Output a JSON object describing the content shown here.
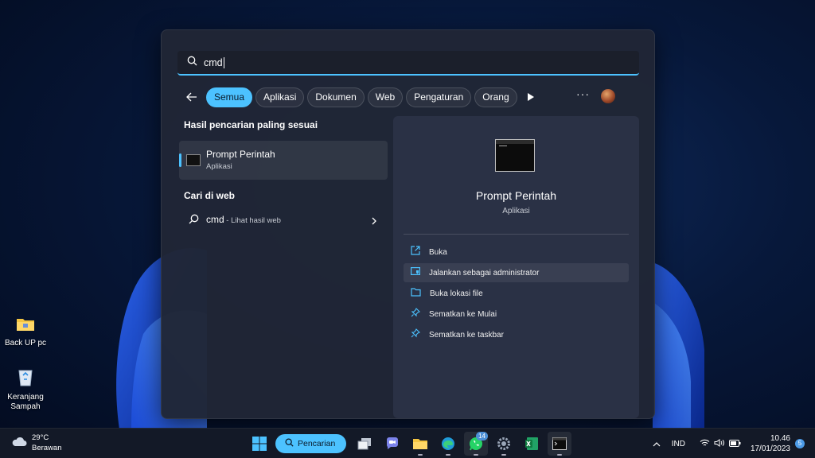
{
  "desktop": {
    "icons": [
      {
        "label": "Back UP pc",
        "icon": "folder-icon"
      },
      {
        "label": "Keranjang Sampah",
        "icon": "recycle-bin-icon"
      }
    ]
  },
  "search": {
    "query": "cmd",
    "filters": [
      "Semua",
      "Aplikasi",
      "Dokumen",
      "Web",
      "Pengaturan",
      "Orang"
    ],
    "active_filter": "Semua",
    "more_label": "···"
  },
  "results": {
    "best_match_title": "Hasil pencarian paling sesuai",
    "best_match": {
      "name": "Prompt Perintah",
      "type": "Aplikasi"
    },
    "web_title": "Cari di web",
    "web_row": {
      "query": "cmd",
      "suffix": " - Lihat hasil web"
    }
  },
  "detail": {
    "app_name": "Prompt Perintah",
    "app_type": "Aplikasi",
    "actions": [
      {
        "label": "Buka",
        "icon": "open-external-icon"
      },
      {
        "label": "Jalankan sebagai administrator",
        "icon": "admin-shield-icon"
      },
      {
        "label": "Buka lokasi file",
        "icon": "folder-icon"
      },
      {
        "label": "Sematkan ke Mulai",
        "icon": "pin-icon"
      },
      {
        "label": "Sematkan ke taskbar",
        "icon": "pin-icon"
      }
    ]
  },
  "taskbar": {
    "weather": {
      "temp": "29°C",
      "condition": "Berawan"
    },
    "search_label": "Pencarian",
    "whatsapp_badge": "14",
    "language": "IND",
    "time": "10.46",
    "date": "17/01/2023",
    "notification_count": "5"
  },
  "colors": {
    "accent": "#4cc2ff",
    "panel": "#202636"
  }
}
